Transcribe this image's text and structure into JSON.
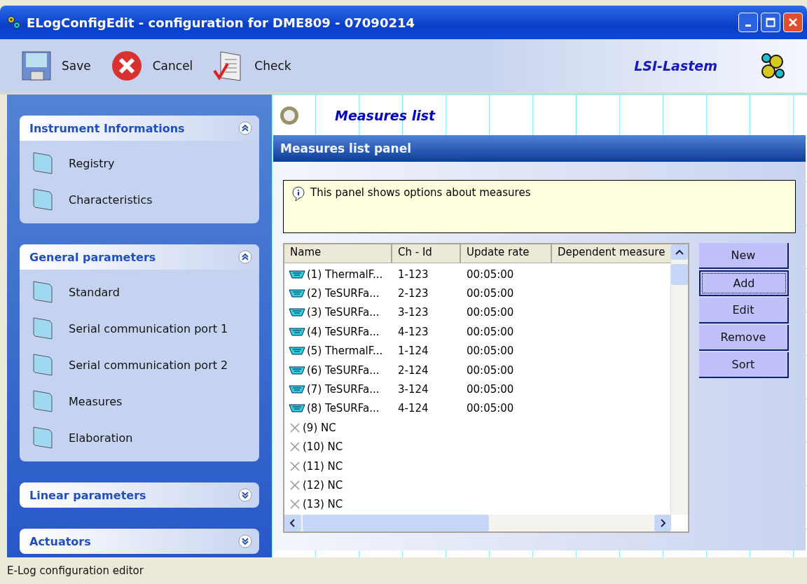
{
  "window": {
    "title": "ELogConfigEdit - configuration for DME809 - 07090214"
  },
  "toolbar": [
    {
      "label": "Save",
      "kind": "save"
    },
    {
      "label": "Cancel",
      "kind": "cancel"
    },
    {
      "label": "Check",
      "kind": "check"
    }
  ],
  "brand": "LSI-Lastem",
  "sidebar": {
    "groups": [
      {
        "title": "Instrument Informations",
        "expanded": true,
        "items": [
          "Registry",
          "Characteristics"
        ]
      },
      {
        "title": "General parameters",
        "expanded": true,
        "items": [
          "Standard",
          "Serial communication port 1",
          "Serial communication port 2",
          "Measures",
          "Elaboration"
        ]
      },
      {
        "title": "Linear parameters",
        "expanded": false
      },
      {
        "title": "Actuators",
        "expanded": false
      }
    ]
  },
  "page_title": "Measures list",
  "panel": {
    "title": "Measures list panel",
    "info": "This panel shows options about measures"
  },
  "table": {
    "columns": [
      "Name",
      "Ch - Id",
      "Update rate",
      "Dependent measure"
    ],
    "rows": [
      {
        "kind": "measure",
        "name": "(1) ThermalF...",
        "ch_id": "1-123",
        "update_rate": "00:05:00"
      },
      {
        "kind": "measure",
        "name": "(2) TeSURFa...",
        "ch_id": "2-123",
        "update_rate": "00:05:00"
      },
      {
        "kind": "measure",
        "name": "(3) TeSURFa...",
        "ch_id": "3-123",
        "update_rate": "00:05:00"
      },
      {
        "kind": "measure",
        "name": "(4) TeSURFa...",
        "ch_id": "4-123",
        "update_rate": "00:05:00"
      },
      {
        "kind": "measure",
        "name": "(5) ThermalF...",
        "ch_id": "1-124",
        "update_rate": "00:05:00"
      },
      {
        "kind": "measure",
        "name": "(6) TeSURFa...",
        "ch_id": "2-124",
        "update_rate": "00:05:00"
      },
      {
        "kind": "measure",
        "name": "(7) TeSURFa...",
        "ch_id": "3-124",
        "update_rate": "00:05:00"
      },
      {
        "kind": "measure",
        "name": "(8) TeSURFa...",
        "ch_id": "4-124",
        "update_rate": "00:05:00"
      },
      {
        "kind": "nc",
        "name": "(9) NC"
      },
      {
        "kind": "nc",
        "name": "(10) NC"
      },
      {
        "kind": "nc",
        "name": "(11) NC"
      },
      {
        "kind": "nc",
        "name": "(12) NC"
      },
      {
        "kind": "nc",
        "name": "(13) NC"
      }
    ]
  },
  "buttons": [
    {
      "label": "New",
      "focused": false
    },
    {
      "label": "Add",
      "focused": true
    },
    {
      "label": "Edit",
      "focused": false
    },
    {
      "label": "Remove",
      "focused": false
    },
    {
      "label": "Sort",
      "focused": false
    }
  ],
  "status_bar": "E-Log configuration editor"
}
